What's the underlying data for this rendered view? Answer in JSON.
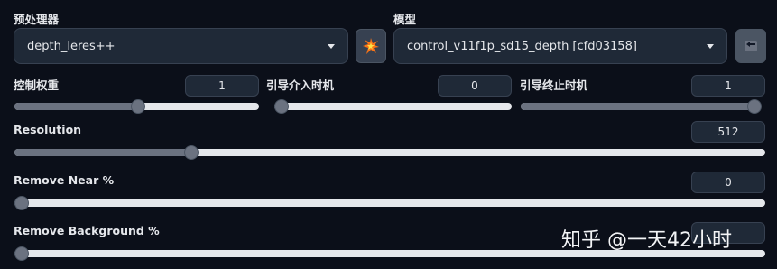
{
  "preprocessor": {
    "label": "预处理器",
    "value": "depth_leres++"
  },
  "model": {
    "label": "模型",
    "value": "control_v11f1p_sd15_depth [cfd03158]"
  },
  "sliders": {
    "control_weight": {
      "label": "控制权重",
      "value": "1",
      "fraction": 0.5
    },
    "guidance_start": {
      "label": "引导介入时机",
      "value": "0",
      "fraction": 0.0
    },
    "guidance_end": {
      "label": "引导终止时机",
      "value": "1",
      "fraction": 1.0
    },
    "resolution": {
      "label": "Resolution",
      "value": "512",
      "fraction": 0.23
    },
    "remove_near": {
      "label": "Remove Near %",
      "value": "0",
      "fraction": 0.0
    },
    "remove_background": {
      "label": "Remove Background %",
      "value": "",
      "fraction": 0.0
    }
  },
  "icons": {
    "run_preprocessor": "explosion-icon",
    "send_model": "arrow-left-icon"
  },
  "colors": {
    "background": "#0b0f19",
    "panel": "#1f2937",
    "track": "#e5e7eb",
    "thumb": "#6b7280"
  },
  "watermark": "知乎 @一天42小时"
}
